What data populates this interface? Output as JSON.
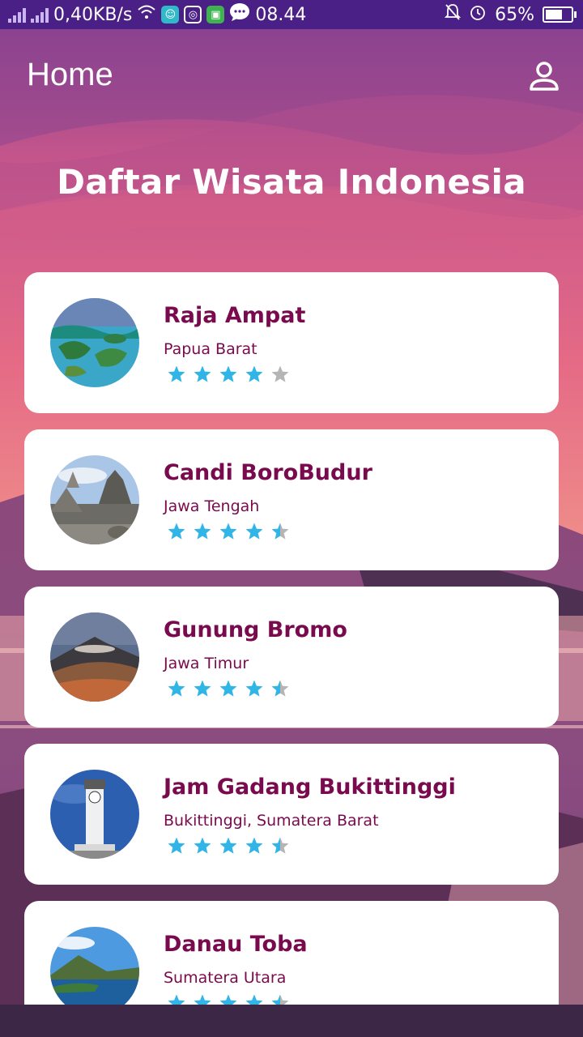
{
  "status_bar": {
    "network_speed": "0,40KB/s",
    "time": "08.44",
    "battery": "65%",
    "icons": [
      "signal-icon",
      "signal-icon",
      "wifi-icon",
      "app-icon",
      "instagram-icon",
      "android-icon",
      "chat-icon",
      "mute-icon",
      "alarm-icon",
      "battery-icon"
    ]
  },
  "header": {
    "title": "Home",
    "profile_icon": "person-icon"
  },
  "page_title": "Daftar Wisata Indonesia",
  "colors": {
    "status_bar": "#4a1f86",
    "title_text": "#7a0a4e",
    "star_filled": "#30b5e6",
    "star_empty": "#b5b5b5",
    "card": "#ffffff"
  },
  "destinations": [
    {
      "name": "Raja Ampat",
      "location": "Papua Barat",
      "rating": 4
    },
    {
      "name": "Candi BoroBudur",
      "location": "Jawa Tengah",
      "rating": 4.5
    },
    {
      "name": "Gunung Bromo",
      "location": "Jawa Timur",
      "rating": 4.5
    },
    {
      "name": "Jam Gadang Bukittinggi",
      "location": "Bukittinggi, Sumatera Barat",
      "rating": 4.5
    },
    {
      "name": "Danau Toba",
      "location": "Sumatera Utara",
      "rating": 4.5
    }
  ]
}
